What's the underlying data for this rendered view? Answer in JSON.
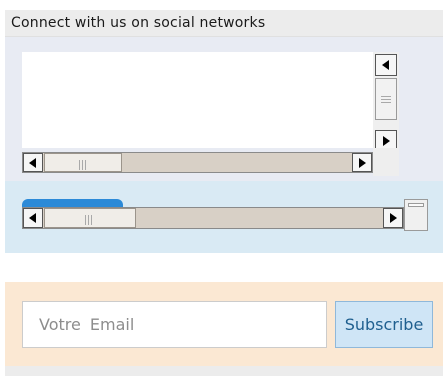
{
  "header": {
    "title": "Connect with us on social networks"
  },
  "social_frame": {
    "scroll_up_icon": "triangle-left-icon",
    "scroll_down_icon": "triangle-right-icon",
    "scroll_left_icon": "triangle-left-icon",
    "scroll_right_icon": "triangle-right-icon"
  },
  "newsletter": {
    "email_placeholder": "Votre Email",
    "subscribe_label": "Subscribe"
  },
  "colors": {
    "accent": "#2b8ad8",
    "social_bg": "#e8ebf3",
    "second_bg": "#d9eaf4",
    "newsletter_bg": "#fbe8d3",
    "button_bg": "#cfe5f6"
  }
}
